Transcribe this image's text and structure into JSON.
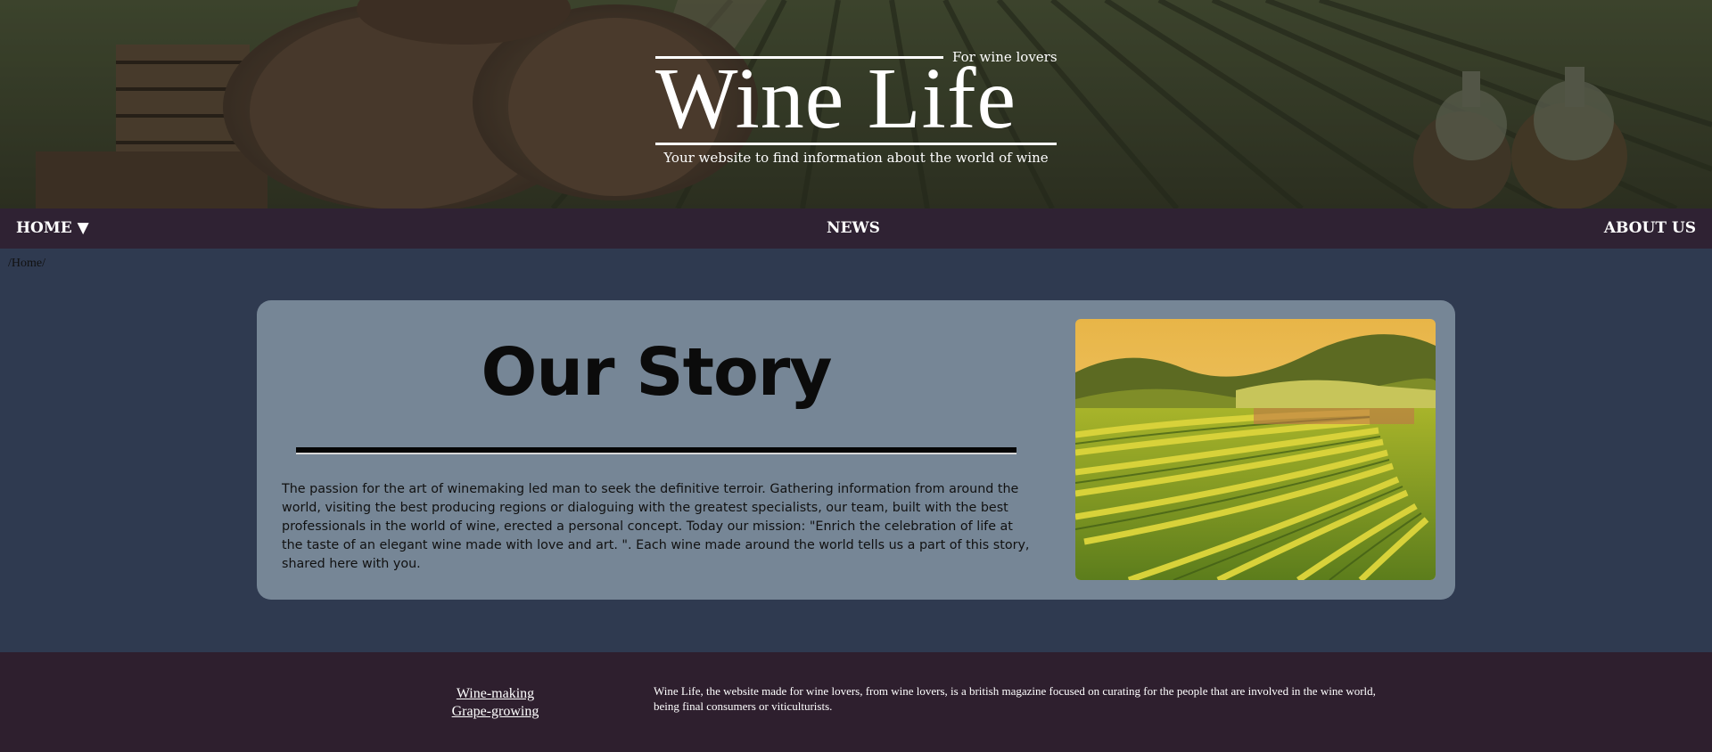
{
  "header": {
    "tagline_top": "For wine lovers",
    "title": "Wine Life",
    "subtitle": "Your website to find information about the world of wine"
  },
  "nav": {
    "home": "HOME",
    "home_caret": "▼",
    "news": "NEWS",
    "about": "ABOUT US"
  },
  "breadcrumb": "/Home/",
  "story": {
    "title": "Our Story",
    "text": "The passion for the art of winemaking led man to seek the definitive terroir. Gathering information from around the world, visiting the best producing regions or dialoguing with the greatest specialists, our team, built with the best professionals in the world of wine, erected a personal concept. Today our mission: \"Enrich the celebration of life at the taste of an elegant wine made with love and art. \". Each wine made around the world tells us a part of this story, shared here with you."
  },
  "footer": {
    "links": [
      "Wine-making",
      "Grape-growing"
    ],
    "about": "Wine Life, the website made for wine lovers, from wine lovers, is a british magazine focused on curating for the people that are involved in the wine world, being final consumers or viticulturists."
  },
  "colors": {
    "nav_bg": "#2f2233",
    "page_bg": "#2f3a50",
    "card_bg": "#768696",
    "footer_bg": "#2e1f2e"
  }
}
